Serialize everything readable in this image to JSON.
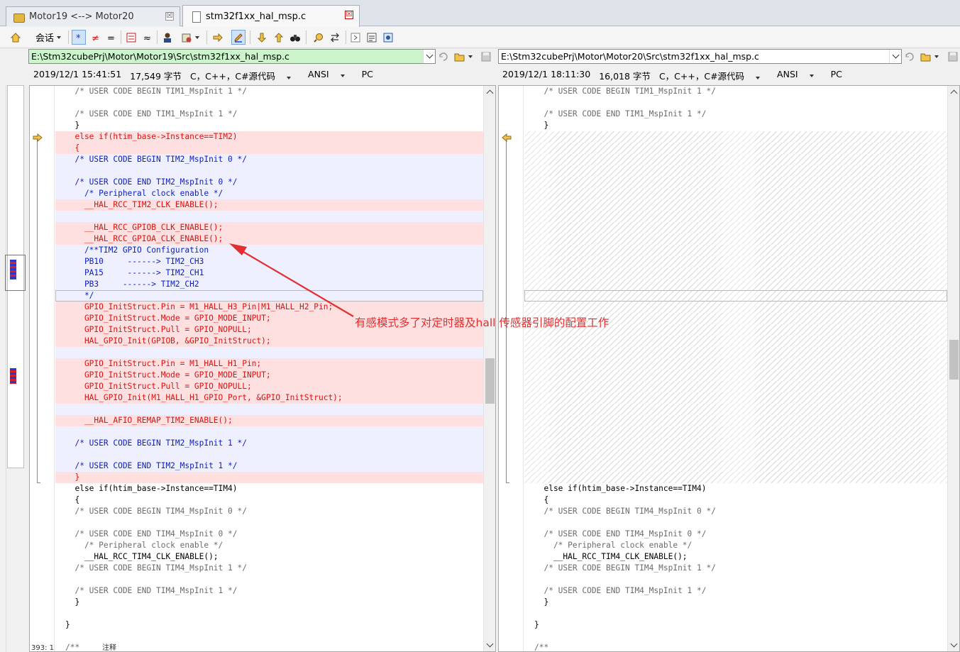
{
  "tabs": [
    {
      "label": "Motor19 <--> Motor20",
      "active": false,
      "close": "☒"
    },
    {
      "label": "stm32f1xx_hal_msp.c",
      "active": true,
      "close": "☒"
    }
  ],
  "toolbar": {
    "session_label": "会话",
    "items": [
      "home-icon",
      "session-menu",
      "all-diffs-toggle",
      "diffs-only-toggle",
      "same-only-toggle",
      "ignore-unimportant-icon",
      "similar-icon",
      "rules-person-icon",
      "format-icon",
      "next-section-icon",
      "edit-icon",
      "next-diff-icon",
      "prev-diff-icon",
      "find-icon",
      "binoculars-icon",
      "swap-icon",
      "expand-icon",
      "details-icon",
      "settings-icon"
    ]
  },
  "left": {
    "path": "E:\\Stm32cubePrj\\Motor\\Motor19\\Src\\stm32f1xx_hal_msp.c",
    "info": {
      "date": "2019/12/1 15:41:51",
      "size": "17,549 字节",
      "format": "C，C++，C#源代码",
      "encoding": "ANSI",
      "lineend": "PC"
    },
    "lines": [
      {
        "t": "  /* USER CODE BEGIN TIM1_MspInit 1 */",
        "k": "eq cmt"
      },
      {
        "t": "",
        "k": "eq"
      },
      {
        "t": "  /* USER CODE END TIM1_MspInit 1 */",
        "k": "eq cmt"
      },
      {
        "t": "  }",
        "k": "eq"
      },
      {
        "t": "  else if(htim_base->Instance==TIM2)",
        "k": "del"
      },
      {
        "t": "  {",
        "k": "del"
      },
      {
        "t": "  /* USER CODE BEGIN TIM2_MspInit 0 */",
        "k": "mod cmt"
      },
      {
        "t": "",
        "k": "mod"
      },
      {
        "t": "  /* USER CODE END TIM2_MspInit 0 */",
        "k": "mod cmt"
      },
      {
        "t": "    /* Peripheral clock enable */",
        "k": "mod cmt"
      },
      {
        "t": "    __HAL_RCC_TIM2_CLK_ENABLE();",
        "k": "del"
      },
      {
        "t": "",
        "k": "mod"
      },
      {
        "t": "    __HAL_RCC_GPIOB_CLK_ENABLE();",
        "k": "del"
      },
      {
        "t": "    __HAL_RCC_GPIOA_CLK_ENABLE();",
        "k": "del"
      },
      {
        "t": "    /**TIM2 GPIO Configuration",
        "k": "mod"
      },
      {
        "t": "    PB10     ------> TIM2_CH3",
        "k": "mod"
      },
      {
        "t": "    PA15     ------> TIM2_CH1",
        "k": "mod"
      },
      {
        "t": "    PB3     ------> TIM2_CH2",
        "k": "mod"
      },
      {
        "t": "    */",
        "k": "mod cur"
      },
      {
        "t": "    GPIO_InitStruct.Pin = M1_HALL_H3_Pin|M1_HALL_H2_Pin;",
        "k": "del"
      },
      {
        "t": "    GPIO_InitStruct.Mode = GPIO_MODE_INPUT;",
        "k": "del"
      },
      {
        "t": "    GPIO_InitStruct.Pull = GPIO_NOPULL;",
        "k": "del"
      },
      {
        "t": "    HAL_GPIO_Init(GPIOB, &GPIO_InitStruct);",
        "k": "del"
      },
      {
        "t": "",
        "k": "mod"
      },
      {
        "t": "    GPIO_InitStruct.Pin = M1_HALL_H1_Pin;",
        "k": "del"
      },
      {
        "t": "    GPIO_InitStruct.Mode = GPIO_MODE_INPUT;",
        "k": "del"
      },
      {
        "t": "    GPIO_InitStruct.Pull = GPIO_NOPULL;",
        "k": "del"
      },
      {
        "t": "    HAL_GPIO_Init(M1_HALL_H1_GPIO_Port, &GPIO_InitStruct);",
        "k": "del"
      },
      {
        "t": "",
        "k": "mod"
      },
      {
        "t": "    __HAL_AFIO_REMAP_TIM2_ENABLE();",
        "k": "del"
      },
      {
        "t": "",
        "k": "mod"
      },
      {
        "t": "  /* USER CODE BEGIN TIM2_MspInit 1 */",
        "k": "mod cmt"
      },
      {
        "t": "",
        "k": "mod"
      },
      {
        "t": "  /* USER CODE END TIM2_MspInit 1 */",
        "k": "mod cmt"
      },
      {
        "t": "  }",
        "k": "del"
      },
      {
        "t": "  else if(htim_base->Instance==TIM4)",
        "k": "eq"
      },
      {
        "t": "  {",
        "k": "eq"
      },
      {
        "t": "  /* USER CODE BEGIN TIM4_MspInit 0 */",
        "k": "eq cmt"
      },
      {
        "t": "",
        "k": "eq"
      },
      {
        "t": "  /* USER CODE END TIM4_MspInit 0 */",
        "k": "eq cmt"
      },
      {
        "t": "    /* Peripheral clock enable */",
        "k": "eq cmt"
      },
      {
        "t": "    __HAL_RCC_TIM4_CLK_ENABLE();",
        "k": "eq"
      },
      {
        "t": "  /* USER CODE BEGIN TIM4_MspInit 1 */",
        "k": "eq cmt"
      },
      {
        "t": "",
        "k": "eq"
      },
      {
        "t": "  /* USER CODE END TIM4_MspInit 1 */",
        "k": "eq cmt"
      },
      {
        "t": "  }",
        "k": "eq"
      },
      {
        "t": "",
        "k": "eq"
      },
      {
        "t": "}",
        "k": "eq"
      },
      {
        "t": "",
        "k": "eq"
      },
      {
        "t": "/**",
        "k": "eq cmt"
      }
    ],
    "status_line": "393: 1",
    "status_kind": "注释"
  },
  "right": {
    "path": "E:\\Stm32cubePrj\\Motor\\Motor20\\Src\\stm32f1xx_hal_msp.c",
    "info": {
      "date": "2019/12/1 18:11:30",
      "size": "16,018 字节",
      "format": "C，C++，C#源代码",
      "encoding": "ANSI",
      "lineend": "PC"
    },
    "lines": [
      {
        "t": "  /* USER CODE BEGIN TIM1_MspInit 1 */",
        "k": "eq cmt"
      },
      {
        "t": "",
        "k": "eq"
      },
      {
        "t": "  /* USER CODE END TIM1_MspInit 1 */",
        "k": "eq cmt"
      },
      {
        "t": "  }",
        "k": "eq"
      },
      {
        "t": "",
        "k": "hatch"
      },
      {
        "t": "",
        "k": "hatch"
      },
      {
        "t": "",
        "k": "hatch"
      },
      {
        "t": "",
        "k": "hatch"
      },
      {
        "t": "",
        "k": "hatch"
      },
      {
        "t": "",
        "k": "hatch"
      },
      {
        "t": "",
        "k": "hatch"
      },
      {
        "t": "",
        "k": "hatch"
      },
      {
        "t": "",
        "k": "hatch"
      },
      {
        "t": "",
        "k": "hatch"
      },
      {
        "t": "",
        "k": "hatch"
      },
      {
        "t": "",
        "k": "hatch"
      },
      {
        "t": "",
        "k": "hatch"
      },
      {
        "t": "",
        "k": "hatch"
      },
      {
        "t": "",
        "k": "hatch cur"
      },
      {
        "t": "",
        "k": "hatch"
      },
      {
        "t": "",
        "k": "hatch"
      },
      {
        "t": "",
        "k": "hatch"
      },
      {
        "t": "",
        "k": "hatch"
      },
      {
        "t": "",
        "k": "hatch"
      },
      {
        "t": "",
        "k": "hatch"
      },
      {
        "t": "",
        "k": "hatch"
      },
      {
        "t": "",
        "k": "hatch"
      },
      {
        "t": "",
        "k": "hatch"
      },
      {
        "t": "",
        "k": "hatch"
      },
      {
        "t": "",
        "k": "hatch"
      },
      {
        "t": "",
        "k": "hatch"
      },
      {
        "t": "",
        "k": "hatch"
      },
      {
        "t": "",
        "k": "hatch"
      },
      {
        "t": "",
        "k": "hatch"
      },
      {
        "t": "",
        "k": "hatch"
      },
      {
        "t": "  else if(htim_base->Instance==TIM4)",
        "k": "eq"
      },
      {
        "t": "  {",
        "k": "eq"
      },
      {
        "t": "  /* USER CODE BEGIN TIM4_MspInit 0 */",
        "k": "eq cmt"
      },
      {
        "t": "",
        "k": "eq"
      },
      {
        "t": "  /* USER CODE END TIM4_MspInit 0 */",
        "k": "eq cmt"
      },
      {
        "t": "    /* Peripheral clock enable */",
        "k": "eq cmt"
      },
      {
        "t": "    __HAL_RCC_TIM4_CLK_ENABLE();",
        "k": "eq"
      },
      {
        "t": "  /* USER CODE BEGIN TIM4_MspInit 1 */",
        "k": "eq cmt"
      },
      {
        "t": "",
        "k": "eq"
      },
      {
        "t": "  /* USER CODE END TIM4_MspInit 1 */",
        "k": "eq cmt"
      },
      {
        "t": "  }",
        "k": "eq"
      },
      {
        "t": "",
        "k": "eq"
      },
      {
        "t": "}",
        "k": "eq"
      },
      {
        "t": "",
        "k": "eq"
      },
      {
        "t": "/**",
        "k": "eq cmt"
      }
    ]
  },
  "annotation": {
    "text": "有感模式多了对定时器及hall 传感器引脚的配置工作",
    "color": "#e23030"
  },
  "colors": {
    "deleted_bg": "#ffe0e0",
    "deleted_fg": "#d11111",
    "modified_bg": "#eef0ff",
    "modified_fg": "#1020c0",
    "path_diff_bg": "#ccf5cc"
  }
}
